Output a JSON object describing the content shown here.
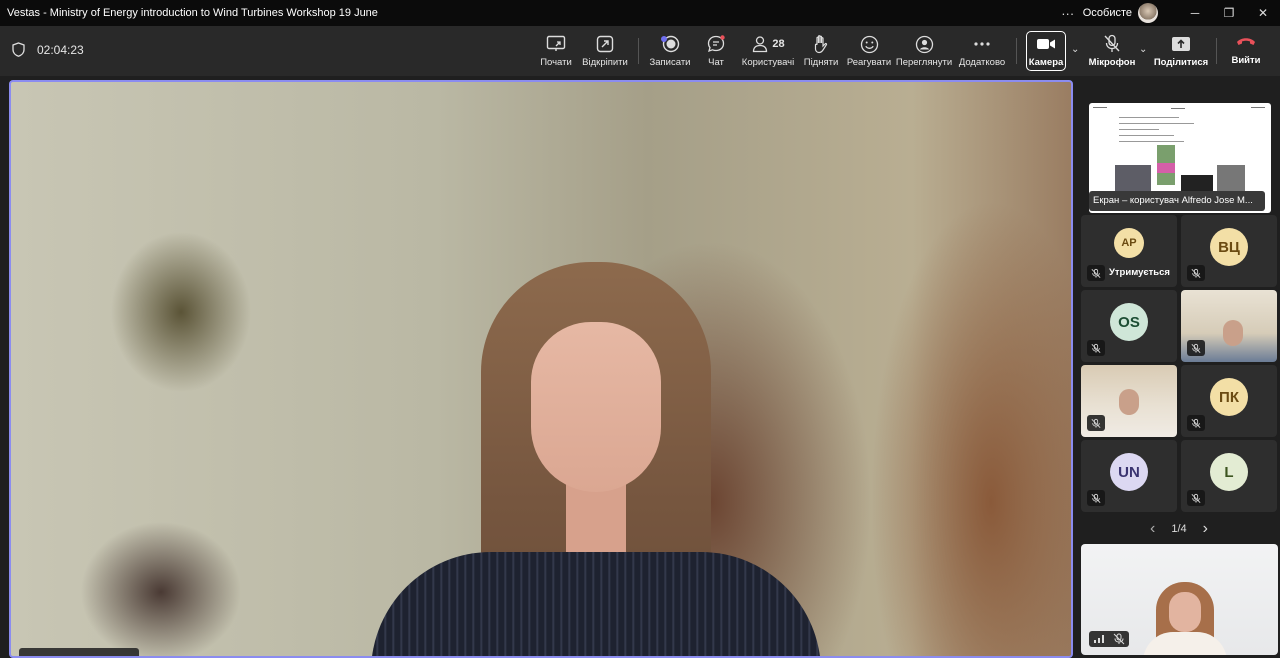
{
  "window": {
    "title": "Vestas - Ministry of Energy introduction to Wind Turbines Workshop 19 June",
    "more": "···",
    "profile": "Особисте",
    "minimize": "─",
    "restore": "❐",
    "close": "✕"
  },
  "toolbar": {
    "timer": "02:04:23",
    "items": [
      {
        "label": "Почати",
        "icon": "share-screen-icon"
      },
      {
        "label": "Відкріпити",
        "icon": "popout-icon"
      },
      {
        "label": "Записати",
        "icon": "record-icon"
      },
      {
        "label": "Чат",
        "icon": "chat-icon"
      },
      {
        "label": "Користувачі",
        "icon": "people-icon",
        "count": "28"
      },
      {
        "label": "Підняти",
        "icon": "raise-hand-icon"
      },
      {
        "label": "Реагувати",
        "icon": "react-icon"
      },
      {
        "label": "Переглянути",
        "icon": "view-icon"
      },
      {
        "label": "Додатково",
        "icon": "more-icon"
      }
    ],
    "camera_label": "Камера",
    "mic_label": "Мікрофон",
    "share_label": "Поділитися",
    "leave_label": "Вийти",
    "leave_color": "#e9515a"
  },
  "panel": {
    "screenshare_label": "Екран – користувач Alfredo Jose M...",
    "participants": [
      {
        "initials": "АР",
        "status": "Утримується",
        "bg": "#f3dfa6",
        "fg": "#6b4b12"
      },
      {
        "initials": "ВЦ",
        "status": "",
        "bg": "#f3dfa6",
        "fg": "#6b4b12"
      },
      {
        "initials": "OS",
        "status": "",
        "bg": "#cfe6d8",
        "fg": "#1c4d33"
      },
      {
        "initials": "",
        "status": "",
        "bg": "video",
        "fg": ""
      },
      {
        "initials": "",
        "status": "",
        "bg": "video",
        "fg": ""
      },
      {
        "initials": "ПК",
        "status": "",
        "bg": "#f3dfa6",
        "fg": "#6b4b12"
      },
      {
        "initials": "UN",
        "status": "",
        "bg": "#dcd8f2",
        "fg": "#3a3370"
      },
      {
        "initials": "L",
        "status": "",
        "bg": "#e3ecd3",
        "fg": "#3d5520"
      }
    ],
    "pager": "1/4",
    "prev": "‹",
    "next": "›"
  },
  "accent": "#8b8cf0"
}
